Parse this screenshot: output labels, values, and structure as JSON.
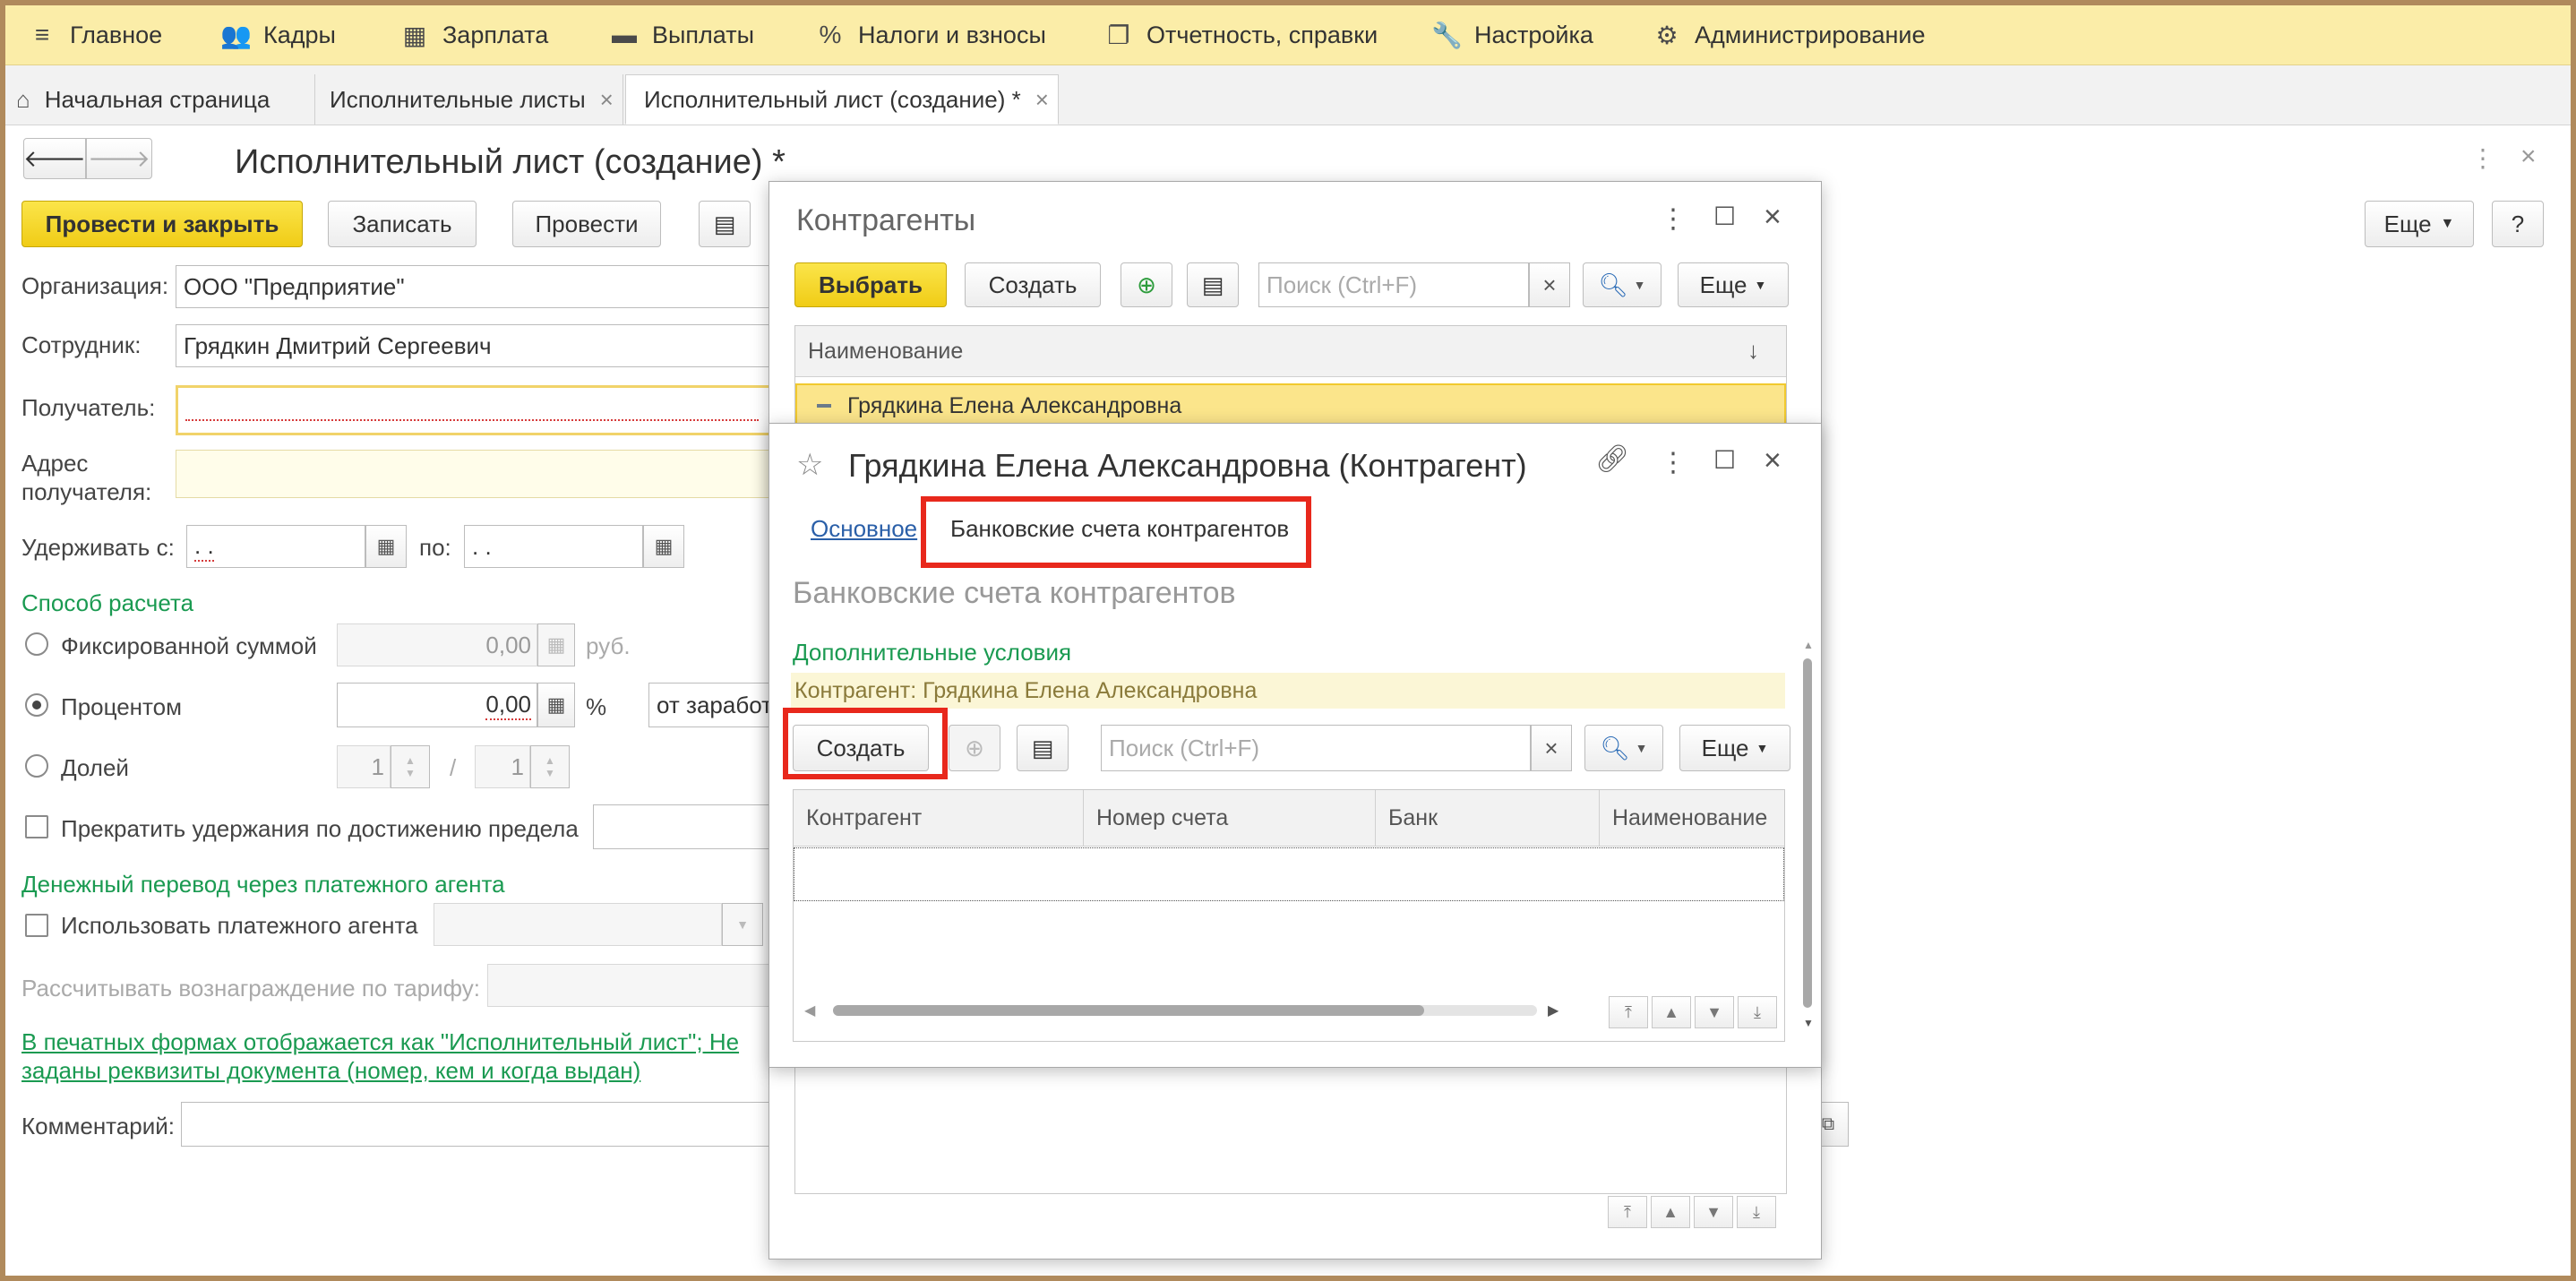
{
  "sections": [
    {
      "icon": "hamburger-icon",
      "label": "Главное"
    },
    {
      "icon": "people-icon",
      "label": "Кадры"
    },
    {
      "icon": "calculator-icon",
      "label": "Зарплата"
    },
    {
      "icon": "wallet-icon",
      "label": "Выплаты"
    },
    {
      "icon": "percent-icon",
      "label": "Налоги и взносы"
    },
    {
      "icon": "reports-icon",
      "label": "Отчетность, справки"
    },
    {
      "icon": "wrench-icon",
      "label": "Настройка"
    },
    {
      "icon": "gear-icon",
      "label": "Администрирование"
    }
  ],
  "tabs": [
    {
      "label": "Начальная страница"
    },
    {
      "label": "Исполнительные листы"
    },
    {
      "label": "Исполнительный лист (создание) *"
    }
  ],
  "doc": {
    "title": "Исполнительный лист (создание) *",
    "buttons": {
      "post_close": "Провести и закрыть",
      "save": "Записать",
      "post": "Провести",
      "more": "Еще",
      "help": "?"
    },
    "org_label": "Организация:",
    "org_value": "ООО \"Предприятие\"",
    "emp_label": "Сотрудник:",
    "emp_value": "Грядкин Дмитрий Сергеевич",
    "recipient_label": "Получатель:",
    "recipient_value": "",
    "address_label_1": "Адрес",
    "address_label_2": "получателя:",
    "hold_from_label": "Удерживать с:",
    "hold_from_value": " .  .",
    "to_label": "по:",
    "to_value": " .  .",
    "calc_section": "Способ расчета",
    "fixed_label": "Фиксированной суммой",
    "fixed_value": "0,00",
    "rub": "руб.",
    "percent_label": "Процентом",
    "percent_value": "0,00",
    "percent_sign": "%",
    "base_value": "от заработ",
    "share_label": "Долей",
    "share_num": "1",
    "share_slash": "/",
    "share_den": "1",
    "stop_label": "Прекратить удержания по достижению предела",
    "transfer_section": "Денежный перевод через платежного агента",
    "use_agent_label": "Использовать платежного агента",
    "tariff_label": "Рассчитывать вознаграждение по тарифу:",
    "print_link_1": "В печатных формах отображается как \"Исполнительный лист\"; Не",
    "print_link_2": "заданы реквизиты документа (номер, кем и когда выдан)",
    "comment_label": "Комментарий:"
  },
  "contractors": {
    "title": "Контрагенты",
    "select": "Выбрать",
    "create": "Создать",
    "search_placeholder": "Поиск (Ctrl+F)",
    "clear": "×",
    "more": "Еще",
    "col_name": "Наименование",
    "sort": "↓",
    "row": "Грядкина Елена Александровна"
  },
  "counterparty": {
    "title": "Грядкина Елена Александровна (Контрагент)",
    "tab_main": "Основное",
    "tab_bank": "Банковские счета контрагентов",
    "heading": "Банковские счета контрагентов",
    "extra_conditions": "Дополнительные условия",
    "filter_text": "Контрагент: Грядкина Елена Александровна",
    "create": "Создать",
    "search_placeholder": "Поиск (Ctrl+F)",
    "clear": "×",
    "more": "Еще",
    "columns": [
      "Контрагент",
      "Номер счета",
      "Банк",
      "Наименование"
    ]
  },
  "colors": {
    "accent": "#f0cc16",
    "section_green": "#1a9a51",
    "highlight": "#e8281c",
    "menu_bg": "#fbeda8"
  }
}
